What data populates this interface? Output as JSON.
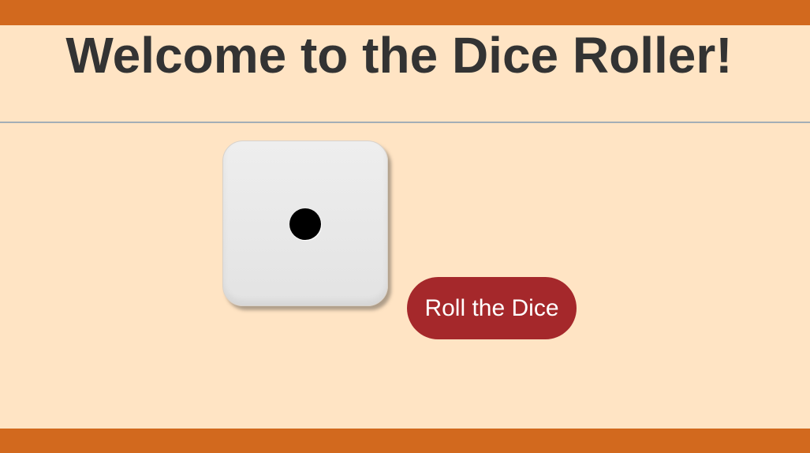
{
  "page": {
    "title": "Welcome to the Dice Roller!"
  },
  "dice": {
    "value": 1
  },
  "roll_button": {
    "label": "Roll the Dice"
  },
  "colors": {
    "background": "#ffe4c4",
    "bars": "#d2691e",
    "button": "#a5282b",
    "title_text": "#333333",
    "divider": "#a3aeb6"
  }
}
